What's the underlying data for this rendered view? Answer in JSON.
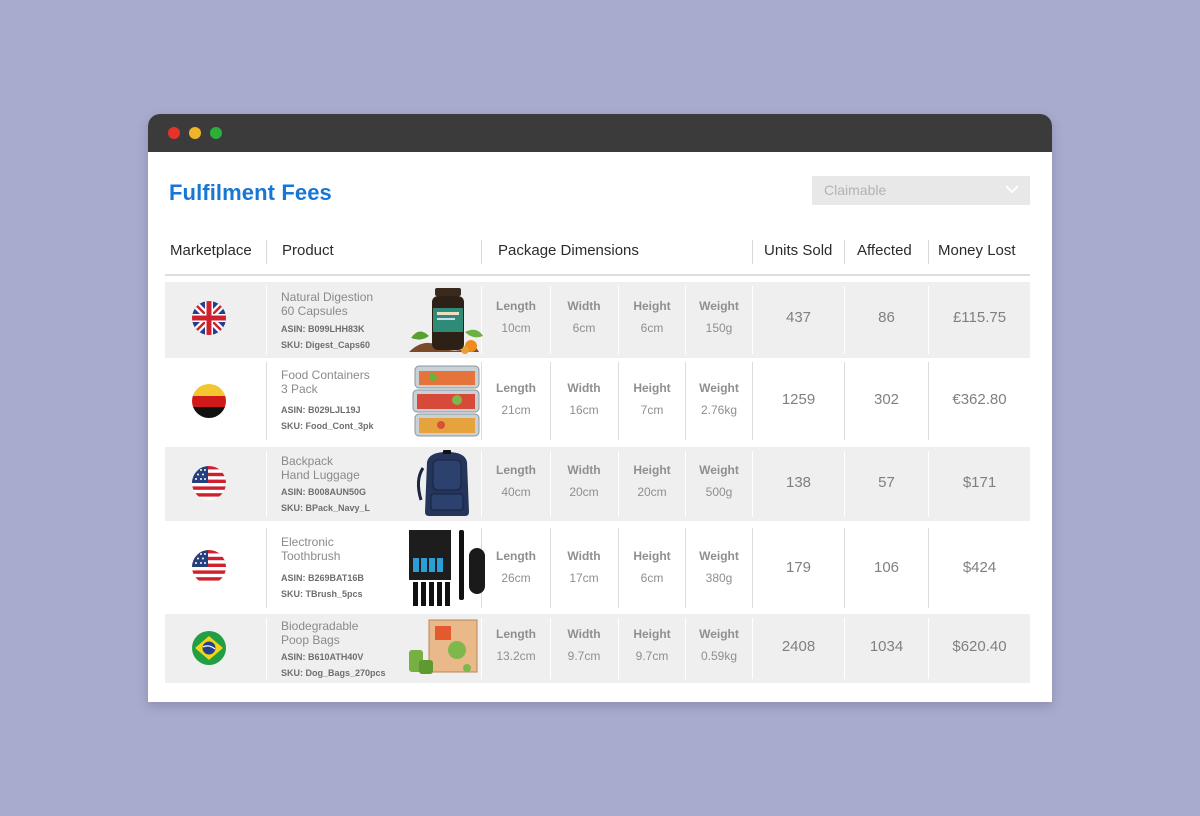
{
  "app": {
    "title": "Fulfilment Fees"
  },
  "filter": {
    "value": "Claimable",
    "icon": "chevron-down-icon"
  },
  "table": {
    "headers": {
      "marketplace": "Marketplace",
      "product": "Product",
      "package_dimensions": "Package Dimensions",
      "units_sold": "Units Sold",
      "affected": "Affected",
      "money_lost": "Money Lost"
    },
    "dim_labels": {
      "length": "Length",
      "width": "Width",
      "height": "Height",
      "weight": "Weight"
    },
    "rows": [
      {
        "flag": "uk-flag-icon",
        "name1": "Natural Digestion",
        "name2": "60 Capsules",
        "asin": "ASIN: B099LHH83K",
        "sku": "SKU: Digest_Caps60",
        "image": "supplement-bottle-image",
        "length": "10cm",
        "width": "6cm",
        "height": "6cm",
        "weight": "150g",
        "units_sold": "437",
        "affected": "86",
        "money_lost": "£115.75"
      },
      {
        "flag": "germany-flag-icon",
        "name1": "Food Containers",
        "name2": "3 Pack",
        "asin": "ASIN: B029LJL19J",
        "sku": "SKU: Food_Cont_3pk",
        "image": "food-containers-image",
        "length": "21cm",
        "width": "16cm",
        "height": "7cm",
        "weight": "2.76kg",
        "units_sold": "1259",
        "affected": "302",
        "money_lost": "€362.80"
      },
      {
        "flag": "usa-flag-icon",
        "name1": "Backpack",
        "name2": "Hand Luggage",
        "asin": "ASIN: B008AUN50G",
        "sku": "SKU: BPack_Navy_L",
        "image": "backpack-image",
        "length": "40cm",
        "width": "20cm",
        "height": "20cm",
        "weight": "500g",
        "units_sold": "138",
        "affected": "57",
        "money_lost": "$171"
      },
      {
        "flag": "usa-flag-icon",
        "name1": "Electronic",
        "name2": "Toothbrush",
        "asin": "ASIN: B269BAT16B",
        "sku": "SKU: TBrush_5pcs",
        "image": "toothbrush-kit-image",
        "length": "26cm",
        "width": "17cm",
        "height": "6cm",
        "weight": "380g",
        "units_sold": "179",
        "affected": "106",
        "money_lost": "$424"
      },
      {
        "flag": "brazil-flag-icon",
        "name1": "Biodegradable",
        "name2": "Poop Bags",
        "asin": "ASIN: B610ATH40V",
        "sku": "SKU: Dog_Bags_270pcs",
        "image": "poop-bags-box-image",
        "length": "13.2cm",
        "width": "9.7cm",
        "height": "9.7cm",
        "weight": "0.59kg",
        "units_sold": "2408",
        "affected": "1034",
        "money_lost": "$620.40"
      }
    ]
  },
  "colors": {
    "background": "#a8abcd",
    "titlebar": "#3b3b3b",
    "accent": "#1677d4",
    "row_shade": "#efefef"
  }
}
